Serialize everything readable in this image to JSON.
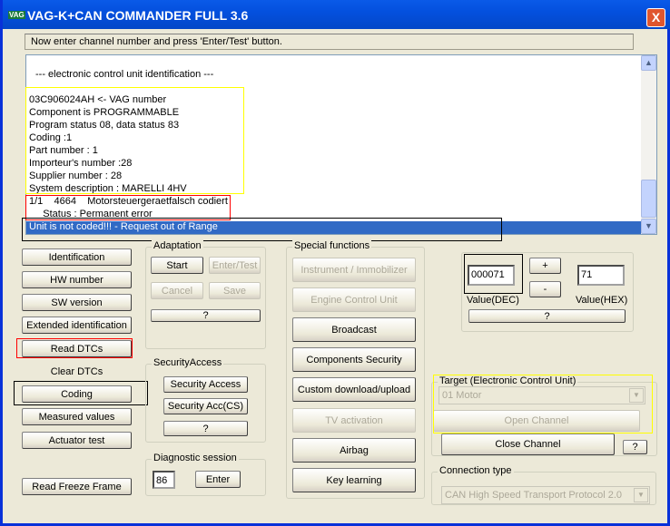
{
  "window": {
    "title": "VAG-K+CAN COMMANDER FULL 3.6",
    "logo": "VAG",
    "close": "X"
  },
  "status": "Now enter channel number and press 'Enter/Test' button.",
  "log": [
    "--- electronic control unit identification ---",
    "03C906024AH  <- VAG number",
    "Component is PROGRAMMABLE",
    "Program status 08, data status 83",
    "Coding :1",
    "Part number : 1",
    "Importeur's number :28",
    "Supplier number : 28",
    "System description :  MARELLI 4HV",
    "1/1    4664    Motorsteuergeraetfalsch codiert",
    "     Status : Permanent error",
    "Unit is not coded!!! - Request out of Range"
  ],
  "left_buttons": [
    "Identification",
    "HW number",
    "SW version",
    "Extended identification",
    "Read DTCs",
    "Clear DTCs",
    "Coding",
    "Measured values",
    "Actuator test",
    "Read Freeze Frame"
  ],
  "adaptation": {
    "title": "Adaptation",
    "start": "Start",
    "enter_test": "Enter/Test",
    "cancel": "Cancel",
    "save": "Save",
    "help": "?"
  },
  "security": {
    "title": "SecurityAccess",
    "access": "Security Access",
    "access_cs": "Security Acc(CS)",
    "help": "?"
  },
  "diag": {
    "title": "Diagnostic session",
    "value": "86",
    "enter": "Enter"
  },
  "special": {
    "title": "Special functions",
    "buttons": [
      "Instrument / Immobilizer",
      "Engine Control Unit",
      "Broadcast",
      "Components Security",
      "Custom download/upload",
      "TV activation",
      "Airbag",
      "Key learning"
    ]
  },
  "value": {
    "dec": "000071",
    "hex": "71",
    "plus": "+",
    "minus": "-",
    "dec_label": "Value(DEC)",
    "hex_label": "Value(HEX)",
    "help": "?"
  },
  "target": {
    "title": "Target (Electronic Control Unit)",
    "selected": "01 Motor",
    "open": "Open Channel",
    "close": "Close Channel",
    "help": "?"
  },
  "connection": {
    "title": "Connection type",
    "selected": "CAN High Speed Transport Protocol 2.0"
  },
  "colors": {
    "title_bar": "#0450de",
    "selection": "#316ac5",
    "highlight_yellow": "#ffff00",
    "highlight_red": "#ff0000"
  }
}
